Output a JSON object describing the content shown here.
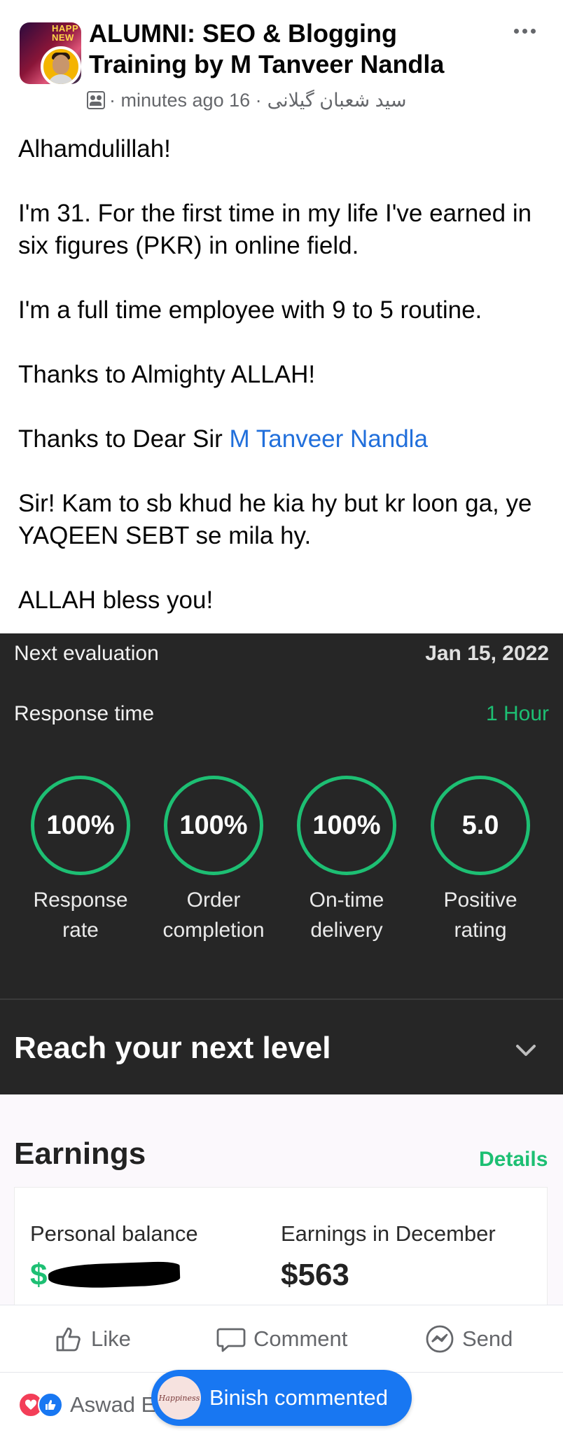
{
  "post": {
    "group_name": "ALUMNI: SEO & Blogging Training by M Tanveer Nandla",
    "author_name": "سید شعبان گیلانی",
    "time_ago": "· minutes ago 16 ·",
    "group_avatar_text": "HAPPY NEW YE",
    "body": {
      "line1": "Alhamdulillah!",
      "line2": "I'm 31. For the first time in my life I've earned in six figures (PKR) in online field.",
      "line3": "I'm a full time employee with 9 to 5 routine.",
      "line4": "Thanks to Almighty ALLAH!",
      "line5_prefix": "Thanks to Dear Sir",
      "line5_mention": "M Tanveer Nandla",
      "line6": "Sir! Kam to sb khud he kia hy but kr loon ga, ye YAQEEN SEBT se mila hy.",
      "line7": "ALLAH bless you!"
    }
  },
  "screenshot": {
    "next_evaluation_label": "Next evaluation",
    "next_evaluation_value": "Jan 15, 2022",
    "response_time_label": "Response time",
    "response_time_value": "1 Hour",
    "metrics": [
      {
        "value": "100%",
        "label_line1": "Response",
        "label_line2": "rate"
      },
      {
        "value": "100%",
        "label_line1": "Order",
        "label_line2": "completion"
      },
      {
        "value": "100%",
        "label_line1": "On-time",
        "label_line2": "delivery"
      },
      {
        "value": "5.0",
        "label_line1": "Positive",
        "label_line2": "rating"
      }
    ],
    "reach_label": "Reach your next level",
    "earnings_title": "Earnings",
    "details_label": "Details",
    "personal_balance_label": "Personal balance",
    "personal_balance_currency": "$",
    "earnings_december_label": "Earnings in December",
    "earnings_december_value": "$563"
  },
  "actions": {
    "like": "Like",
    "comment": "Comment",
    "send": "Send"
  },
  "reactions": {
    "reactor_name": "Aswad E",
    "toast_text": "Binish commented",
    "toast_avatar_text": "Happiness"
  },
  "colors": {
    "accent_green": "#1dbf73",
    "facebook_blue": "#1877f2",
    "mention_blue": "#216fdb",
    "dark_card": "#262626"
  }
}
